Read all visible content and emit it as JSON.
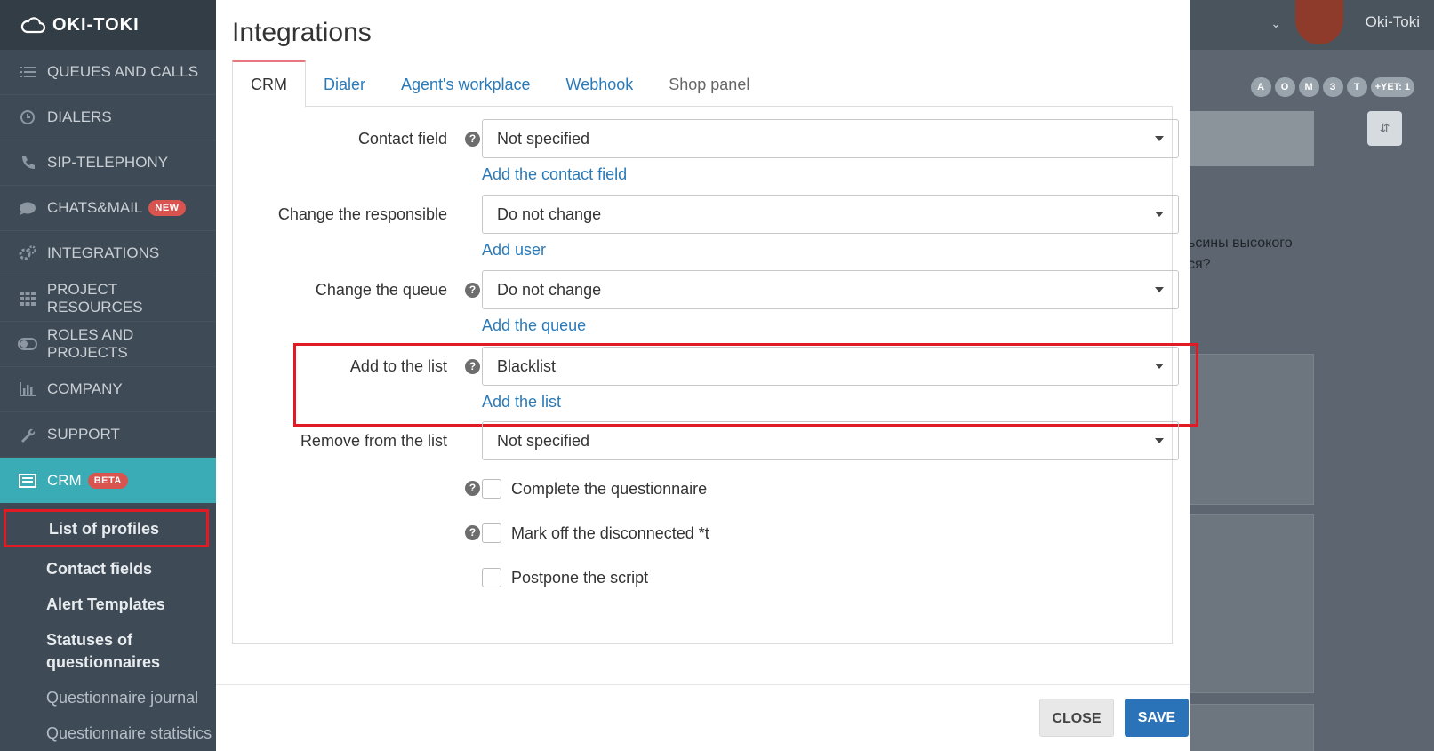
{
  "app": {
    "logo_text": "OKI-TOKI"
  },
  "sidebar": {
    "items": [
      {
        "label": "QUEUES AND CALLS",
        "icon": "list-icon"
      },
      {
        "label": "DIALERS",
        "icon": "clock-icon"
      },
      {
        "label": "SIP-TELEPHONY",
        "icon": "phone-icon"
      },
      {
        "label": "CHATS&MAIL",
        "icon": "chat-icon",
        "badge": "NEW"
      },
      {
        "label": "INTEGRATIONS",
        "icon": "gears-icon"
      },
      {
        "label": "PROJECT RESOURCES",
        "icon": "grid-icon"
      },
      {
        "label": "ROLES AND PROJECTS",
        "icon": "toggle-icon"
      },
      {
        "label": "COMPANY",
        "icon": "bar-chart-icon"
      },
      {
        "label": "SUPPORT",
        "icon": "wrench-icon"
      },
      {
        "label": "CRM",
        "icon": "crm-icon",
        "badge": "BETA"
      }
    ],
    "crm_sub": {
      "list_of_profiles": "List of profiles",
      "contact_fields": "Contact fields",
      "alert_templates": "Alert Templates",
      "statuses_line1": "Statuses of",
      "statuses_line2": "questionnaires",
      "questionnaire_journal": "Questionnaire journal",
      "questionnaire_statistics": "Questionnaire statistics"
    }
  },
  "header": {
    "user_name": "Oki-Toki"
  },
  "background": {
    "badges": [
      "A",
      "O",
      "M",
      "З",
      "T",
      "+YET: 1"
    ],
    "text_line1": "ьсины высокого",
    "text_line2": "ся?"
  },
  "modal": {
    "title": "Integrations",
    "tabs": [
      "CRM",
      "Dialer",
      "Agent's workplace",
      "Webhook",
      "Shop panel"
    ],
    "fields": {
      "contact_field": {
        "label": "Contact field",
        "value": "Not specified",
        "link": "Add the contact field"
      },
      "change_responsible": {
        "label": "Change the responsible",
        "value": "Do not change",
        "link": "Add user"
      },
      "change_queue": {
        "label": "Change the queue",
        "value": "Do not change",
        "link": "Add the queue"
      },
      "add_to_list": {
        "label": "Add to the list",
        "value": "Blacklist",
        "link": "Add the list"
      },
      "remove_from_list": {
        "label": "Remove from the list",
        "value": "Not specified"
      }
    },
    "checkboxes": {
      "complete_questionnaire": "Complete the questionnaire",
      "mark_disconnected": "Mark off the disconnected *t",
      "postpone_script": "Postpone the script"
    },
    "buttons": {
      "close": "CLOSE",
      "save": "SAVE"
    }
  },
  "colors": {
    "sidebar_bg": "#3e4a55",
    "active_teal": "#3aacb6",
    "link_blue": "#2a7ab8",
    "save_blue": "#2a73b9",
    "highlight_red": "#e01b24",
    "badge_red": "#d9534f"
  }
}
